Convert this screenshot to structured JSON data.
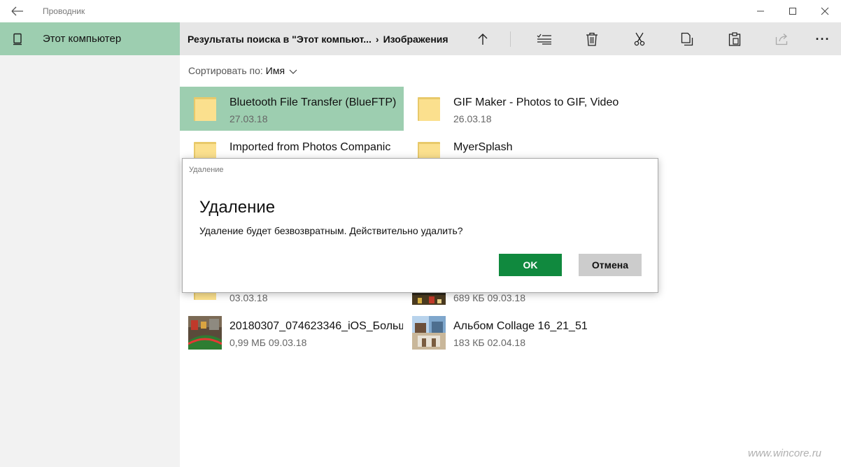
{
  "window": {
    "title": "Проводник"
  },
  "sidebar": {
    "items": [
      {
        "label": "Этот компьютер",
        "icon": "computer-icon",
        "selected": true
      }
    ]
  },
  "toolbar": {
    "breadcrumb": {
      "part1": "Результаты поиска в \"Этот компьют...",
      "separator": "›",
      "part2": "Изображения"
    },
    "commands": [
      "up-arrow-icon",
      "select-icon",
      "delete-icon",
      "cut-icon",
      "copy-icon",
      "paste-icon",
      "share-icon",
      "more-icon"
    ],
    "more_label": "···"
  },
  "sort": {
    "label": "Сортировать по:",
    "value": "Имя"
  },
  "files": [
    {
      "name": "Bluetooth File Transfer (BlueFTP)",
      "meta": "27.03.18",
      "kind": "folder",
      "selected": true
    },
    {
      "name": "GIF Maker - Photos to GIF, Video",
      "meta": "26.03.18",
      "kind": "folder"
    },
    {
      "name": "Imported from Photos Companic",
      "meta": "",
      "kind": "folder"
    },
    {
      "name": "MyerSplash",
      "meta": "",
      "kind": "folder"
    },
    {
      "name": "",
      "meta": "03.03.18",
      "kind": "folder"
    },
    {
      "name": "",
      "meta": "689 КБ 09.03.18",
      "kind": "photo"
    },
    {
      "name": "20180307_074623346_iOS_Больш",
      "meta": "0,99 МБ 09.03.18",
      "kind": "photo"
    },
    {
      "name": "Альбом Collage 16_21_51",
      "meta": "183 КБ 02.04.18",
      "kind": "photo"
    }
  ],
  "dialog": {
    "caption": "Удаление",
    "heading": "Удаление",
    "message": "Удаление будет безвозвратным. Действительно удалить?",
    "ok_label": "OK",
    "cancel_label": "Отмена"
  },
  "watermark": "www.wincore.ru",
  "colors": {
    "accent": "#9dceb0",
    "ok_button": "#10893e",
    "folder": "#fbe08e"
  }
}
